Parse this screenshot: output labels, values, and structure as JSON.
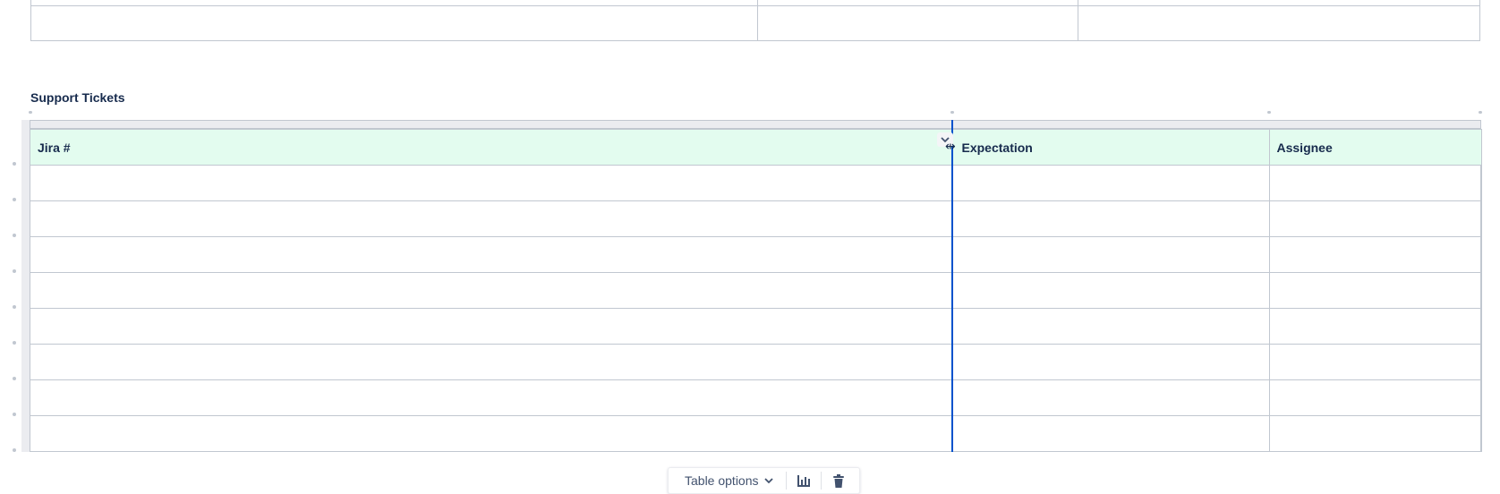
{
  "section_title": "Support Tickets",
  "table": {
    "headers": [
      "Jira #",
      "Expectation",
      "Assignee"
    ],
    "rows": [
      [
        "",
        "",
        ""
      ],
      [
        "",
        "",
        ""
      ],
      [
        "",
        "",
        ""
      ],
      [
        "",
        "",
        ""
      ],
      [
        "",
        "",
        ""
      ],
      [
        "",
        "",
        ""
      ],
      [
        "",
        "",
        ""
      ],
      [
        "",
        "",
        ""
      ]
    ]
  },
  "toolbar": {
    "table_options_label": "Table options",
    "chevron_icon": "chevron-down-icon",
    "chart_icon": "bar-chart-icon",
    "delete_icon": "trash-icon"
  },
  "colors": {
    "header_bg": "#e3fcef",
    "resize_line": "#0052cc",
    "border": "#c1c7d0"
  }
}
